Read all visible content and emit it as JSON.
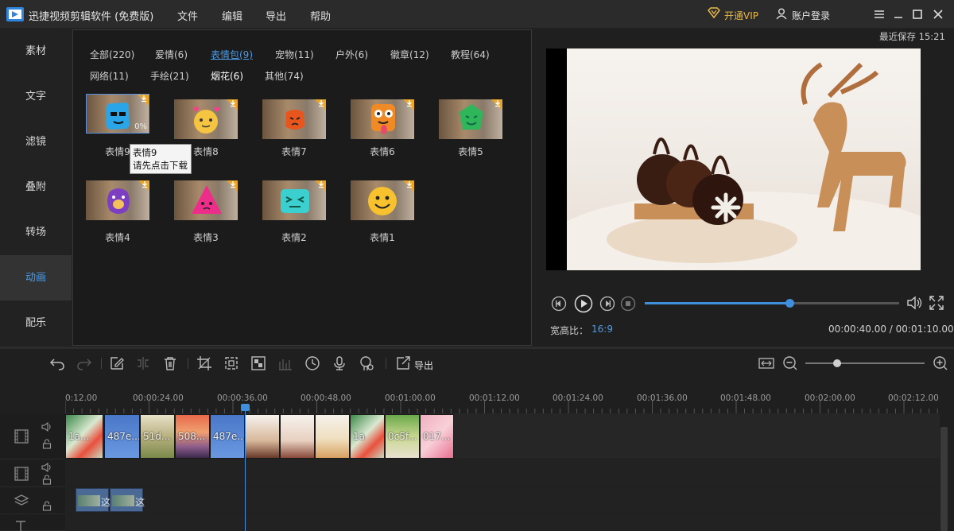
{
  "app": {
    "title": "迅捷视频剪辑软件 (免费版)",
    "menu": [
      "文件",
      "编辑",
      "导出",
      "帮助"
    ],
    "vip_label": "开通VIP",
    "account_label": "账户登录"
  },
  "left_nav": {
    "items": [
      "素材",
      "文字",
      "滤镜",
      "叠附",
      "转场",
      "动画",
      "配乐"
    ],
    "active": "动画"
  },
  "categories": {
    "row1": [
      "全部(220)",
      "爱情(6)",
      "表情包(9)",
      "宠物(11)",
      "户外(6)",
      "徽章(12)",
      "教程(64)"
    ],
    "row2": [
      "网络(11)",
      "手绘(21)",
      "烟花(6)",
      "其他(74)"
    ],
    "active": "表情包(9)"
  },
  "stickers": [
    {
      "label": "表情9",
      "progress": "0%"
    },
    {
      "label": "表情8"
    },
    {
      "label": "表情7"
    },
    {
      "label": "表情6"
    },
    {
      "label": "表情5"
    },
    {
      "label": "表情4"
    },
    {
      "label": "表情3"
    },
    {
      "label": "表情2"
    },
    {
      "label": "表情1"
    }
  ],
  "tooltip": {
    "line1": "表情9",
    "line2": "请先点击下载"
  },
  "preview": {
    "saved": "最近保存 15:21",
    "aspect_label": "宽高比：",
    "aspect_value": "16:9",
    "timecode": "00:00:40.00 / 00:01:10.00",
    "progress": 0.57
  },
  "toolbar": {
    "export_label": "导出"
  },
  "ruler": [
    "0:12.00",
    "00:00:24.00",
    "00:00:36.00",
    "00:00:48.00",
    "00:01:00.00",
    "00:01:12.00",
    "00:01:24.00",
    "00:01:36.00",
    "00:01:48.00",
    "00:02:00.00",
    "00:02:12.00"
  ],
  "clips": [
    "1a...",
    "487e...",
    "51d...",
    "508...",
    "487e...",
    "",
    "",
    "",
    "1a",
    "0c5f...",
    "017..."
  ],
  "overlay_clips": [
    "这",
    "这"
  ],
  "colors": {
    "accent": "#3f8fdd",
    "vip": "#e8b94a",
    "download_badge": "#e8a62a"
  }
}
